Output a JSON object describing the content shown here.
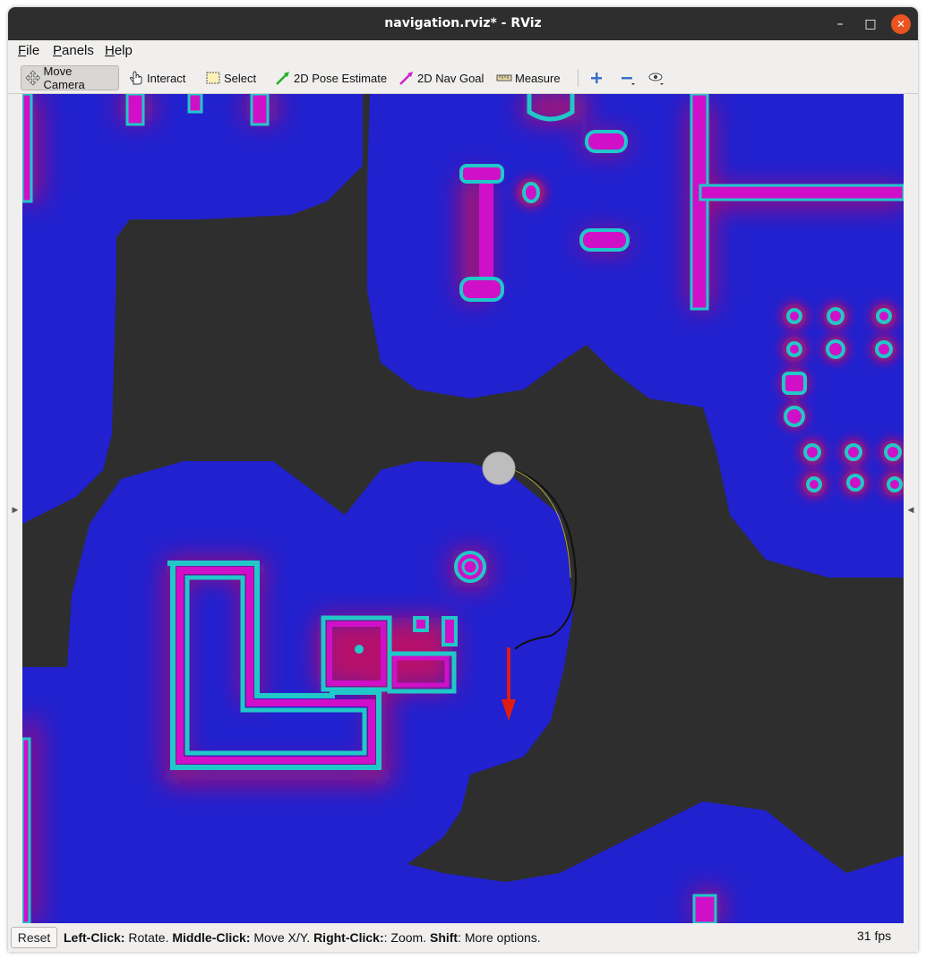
{
  "window": {
    "title": "navigation.rviz* - RViz"
  },
  "menubar": {
    "items": [
      {
        "accel": "F",
        "rest": "ile"
      },
      {
        "accel": "P",
        "rest": "anels"
      },
      {
        "accel": "H",
        "rest": "elp"
      }
    ]
  },
  "toolbar": {
    "move_camera": "Move Camera",
    "interact": "Interact",
    "select": "Select",
    "pose_estimate": "2D Pose Estimate",
    "nav_goal": "2D Nav Goal",
    "measure": "Measure",
    "active_tool": "Move Camera"
  },
  "status": {
    "reset": "Reset",
    "help": [
      {
        "key": "Left-Click:",
        "text": " Rotate. "
      },
      {
        "key": "Middle-Click:",
        "text": " Move X/Y. "
      },
      {
        "key": "Right-Click:",
        "text": ": Zoom. "
      },
      {
        "key": "Shift",
        "text": ": More options."
      }
    ],
    "fps": "31 fps"
  },
  "colors": {
    "free_space": "#2e2e2e",
    "inflation": "#2020d0",
    "lethal": "#d010c8",
    "obstacle_edge": "#20c8c8",
    "robot": "#bdbdbd",
    "goal_arrow": "#e01c10",
    "path": "#111111"
  },
  "icons": [
    "move-camera-icon",
    "interact-icon",
    "select-icon",
    "pose-estimate-icon",
    "nav-goal-icon",
    "measure-icon",
    "zoom-in-icon",
    "zoom-out-icon",
    "view-icon"
  ]
}
